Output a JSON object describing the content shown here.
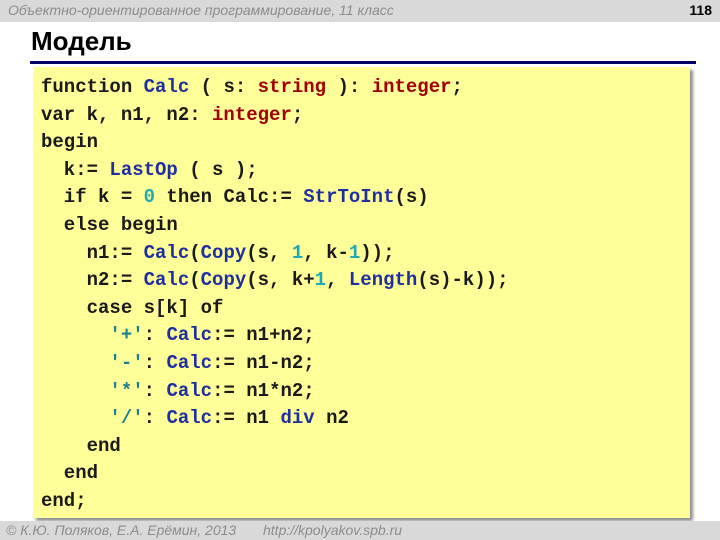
{
  "header": {
    "course_title": "Объектно-ориентированное программирование, 11 класс",
    "slide_number": "118"
  },
  "slide": {
    "title": "Модель"
  },
  "code": {
    "colors": {
      "keyword": "#1a1a1a",
      "identifier": "#1f2fa0",
      "type": "#a00000",
      "number": "#1fa8b8",
      "string": "#1f7f8f",
      "background": "#ffff99"
    },
    "lines": [
      [
        [
          "kw",
          "function "
        ],
        [
          "id",
          "Calc"
        ],
        [
          "kw",
          " ( s: "
        ],
        [
          "ty",
          "string"
        ],
        [
          "kw",
          " ): "
        ],
        [
          "ty",
          "integer"
        ],
        [
          "kw",
          ";"
        ]
      ],
      [
        [
          "kw",
          "var k, n1, n2: "
        ],
        [
          "ty",
          "integer"
        ],
        [
          "kw",
          ";"
        ]
      ],
      [
        [
          "kw",
          "begin"
        ]
      ],
      [
        [
          "kw",
          "  k:= "
        ],
        [
          "id",
          "LastOp"
        ],
        [
          "kw",
          " ( s );"
        ]
      ],
      [
        [
          "kw",
          "  if k = "
        ],
        [
          "num",
          "0"
        ],
        [
          "kw",
          " then Calc:= "
        ],
        [
          "id",
          "StrToInt"
        ],
        [
          "kw",
          "(s)"
        ]
      ],
      [
        [
          "kw",
          "  else begin"
        ]
      ],
      [
        [
          "kw",
          "    n1:= "
        ],
        [
          "id",
          "Calc"
        ],
        [
          "kw",
          "("
        ],
        [
          "id",
          "Copy"
        ],
        [
          "kw",
          "(s, "
        ],
        [
          "num",
          "1"
        ],
        [
          "kw",
          ", k-"
        ],
        [
          "num",
          "1"
        ],
        [
          "kw",
          "));"
        ]
      ],
      [
        [
          "kw",
          "    n2:= "
        ],
        [
          "id",
          "Calc"
        ],
        [
          "kw",
          "("
        ],
        [
          "id",
          "Copy"
        ],
        [
          "kw",
          "(s, k+"
        ],
        [
          "num",
          "1"
        ],
        [
          "kw",
          ", "
        ],
        [
          "id",
          "Length"
        ],
        [
          "kw",
          "(s)-k));"
        ]
      ],
      [
        [
          "kw",
          "    case s[k] of"
        ]
      ],
      [
        [
          "kw",
          "      "
        ],
        [
          "str",
          "'+'"
        ],
        [
          "kw",
          ": "
        ],
        [
          "id",
          "Calc"
        ],
        [
          "kw",
          ":= n1+n2;"
        ]
      ],
      [
        [
          "kw",
          "      "
        ],
        [
          "str",
          "'-'"
        ],
        [
          "kw",
          ": "
        ],
        [
          "id",
          "Calc"
        ],
        [
          "kw",
          ":= n1-n2;"
        ]
      ],
      [
        [
          "kw",
          "      "
        ],
        [
          "str",
          "'*'"
        ],
        [
          "kw",
          ": "
        ],
        [
          "id",
          "Calc"
        ],
        [
          "kw",
          ":= n1*n2;"
        ]
      ],
      [
        [
          "kw",
          "      "
        ],
        [
          "str",
          "'/'"
        ],
        [
          "kw",
          ": "
        ],
        [
          "id",
          "Calc"
        ],
        [
          "kw",
          ":= n1 "
        ],
        [
          "id",
          "div"
        ],
        [
          "kw",
          " n2"
        ]
      ],
      [
        [
          "kw",
          "    end"
        ]
      ],
      [
        [
          "kw",
          "  end"
        ]
      ],
      [
        [
          "kw",
          "end;"
        ]
      ]
    ]
  },
  "footer": {
    "copyright": "© К.Ю. Поляков, Е.А. Ерёмин, 2013",
    "url": "http://kpolyakov.spb.ru"
  }
}
